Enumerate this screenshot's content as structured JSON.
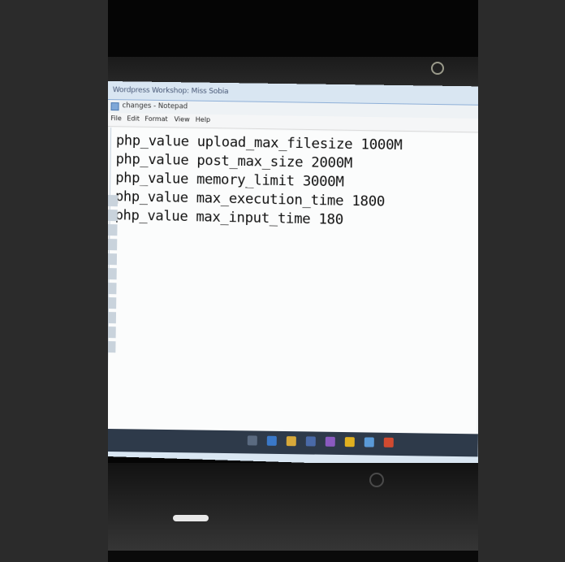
{
  "screen": {
    "window_title": "Wordpress Workshop: Miss Sobia",
    "notepad_title": "changes - Notepad",
    "menu": [
      "File",
      "Edit",
      "Format",
      "View",
      "Help"
    ],
    "lines": [
      "php_value upload_max_filesize 1000M",
      "php_value post_max_size 2000M",
      "php_value memory_limit 3000M",
      "php_value max_execution_time 1800",
      "php_value max_input_time 180"
    ]
  },
  "colors": {
    "screen_bg": "#d9e6f2",
    "notepad_bg": "#fbfcfc",
    "text": "#111111",
    "taskbar": "#2e3a4a"
  }
}
